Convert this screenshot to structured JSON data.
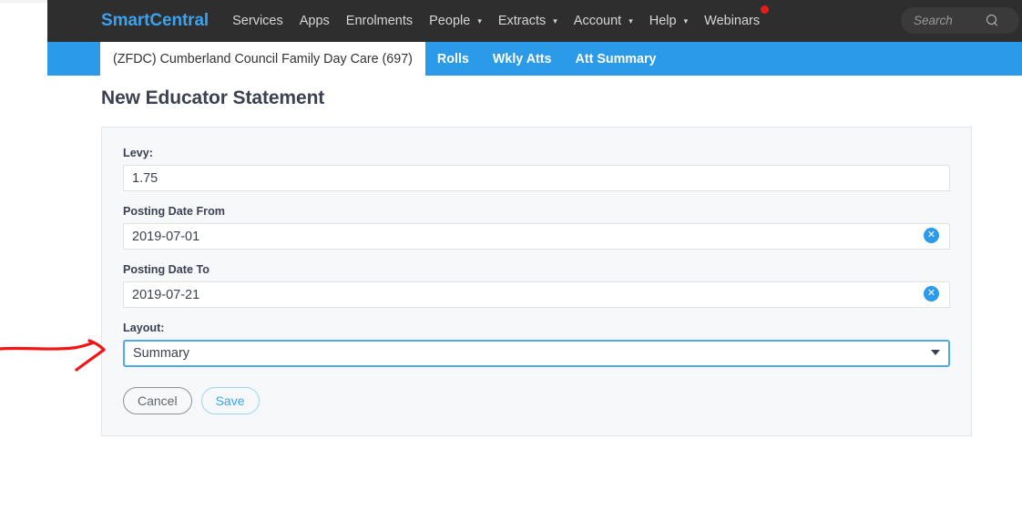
{
  "navbar": {
    "brand": "SmartCentral",
    "items": [
      {
        "label": "Services",
        "caret": false
      },
      {
        "label": "Apps",
        "caret": false
      },
      {
        "label": "Enrolments",
        "caret": false
      },
      {
        "label": "People",
        "caret": true
      },
      {
        "label": "Extracts",
        "caret": true
      },
      {
        "label": "Account",
        "caret": true
      },
      {
        "label": "Help",
        "caret": true
      },
      {
        "label": "Webinars",
        "caret": false
      }
    ],
    "caret_glyph": "▾",
    "notification_dot": true,
    "search": {
      "placeholder": "Search",
      "value": ""
    }
  },
  "subnav": {
    "active_tab": "(ZFDC) Cumberland Council Family Day Care (697)",
    "tabs": [
      "Rolls",
      "Wkly Atts",
      "Att Summary"
    ]
  },
  "page": {
    "title": "New Educator Statement"
  },
  "form": {
    "levy": {
      "label": "Levy:",
      "value": "1.75",
      "placeholder": ""
    },
    "posting_date_from": {
      "label": "Posting Date From",
      "value": "2019-07-01",
      "placeholder": "",
      "clear_glyph": "✕"
    },
    "posting_date_to": {
      "label": "Posting Date To",
      "value": "2019-07-21",
      "placeholder": "",
      "clear_glyph": "✕"
    },
    "layout": {
      "label": "Layout:",
      "value": "Summary",
      "options": [
        "Summary"
      ]
    },
    "buttons": {
      "cancel": "Cancel",
      "save": "Save"
    }
  },
  "colors": {
    "navbar_bg": "#2e2e2e",
    "brand": "#3ba2ee",
    "subnav_bg": "#2b9ae8",
    "accent": "#2b9ae8",
    "focus_border": "#4aaceb",
    "notification": "#e81b1b",
    "annotation": "#f51414",
    "card_bg": "#f7f8fa",
    "text": "#3b4150"
  },
  "annotation": {
    "shape": "red-arrow-pointing-right",
    "target": "layout-select"
  }
}
